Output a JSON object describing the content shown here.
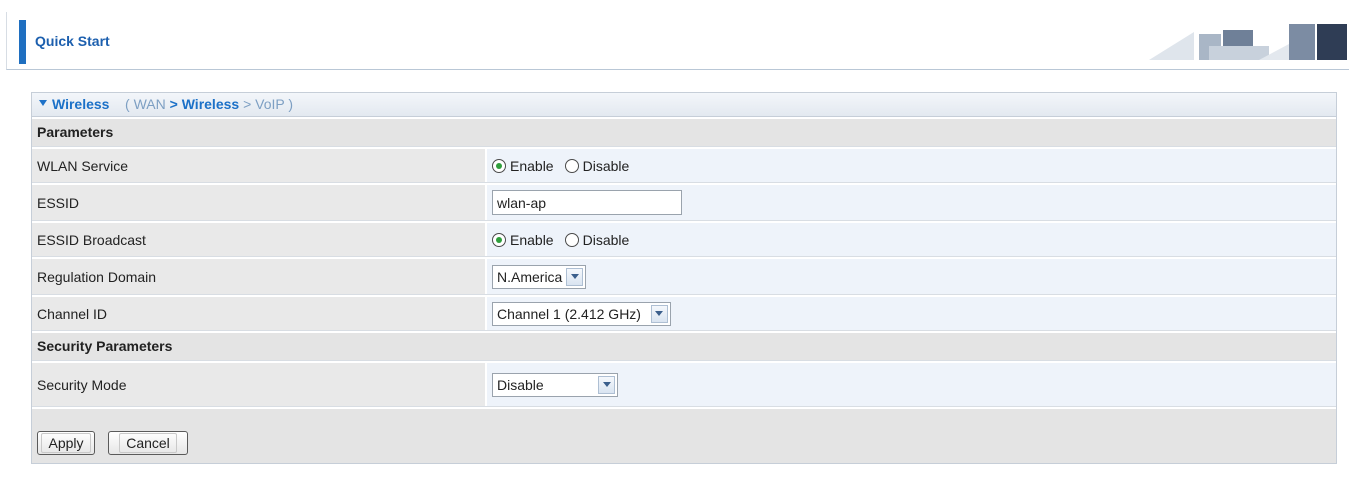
{
  "header": {
    "title": "Quick Start"
  },
  "breadcrumb": {
    "current": "Wireless",
    "path": {
      "open": "(",
      "step1": "WAN",
      "sep1": ">",
      "step2": "Wireless",
      "sep2": ">",
      "step3": "VoIP",
      "close": ")"
    }
  },
  "sections": {
    "parameters": "Parameters",
    "security": "Security Parameters"
  },
  "fields": {
    "wlan_service": {
      "label": "WLAN Service",
      "options": [
        "Enable",
        "Disable"
      ],
      "selected": "Enable"
    },
    "essid": {
      "label": "ESSID",
      "value": "wlan-ap"
    },
    "essid_broadcast": {
      "label": "ESSID Broadcast",
      "options": [
        "Enable",
        "Disable"
      ],
      "selected": "Enable"
    },
    "regulation_domain": {
      "label": "Regulation Domain",
      "value": "N.America"
    },
    "channel_id": {
      "label": "Channel ID",
      "value": "Channel 1 (2.412 GHz)"
    },
    "security_mode": {
      "label": "Security Mode",
      "value": "Disable"
    }
  },
  "buttons": {
    "apply": "Apply",
    "cancel": "Cancel"
  },
  "colors": {
    "accent": "#1f6fc0",
    "link": "#1c71c8",
    "radio_checked": "#2f9e3c"
  }
}
